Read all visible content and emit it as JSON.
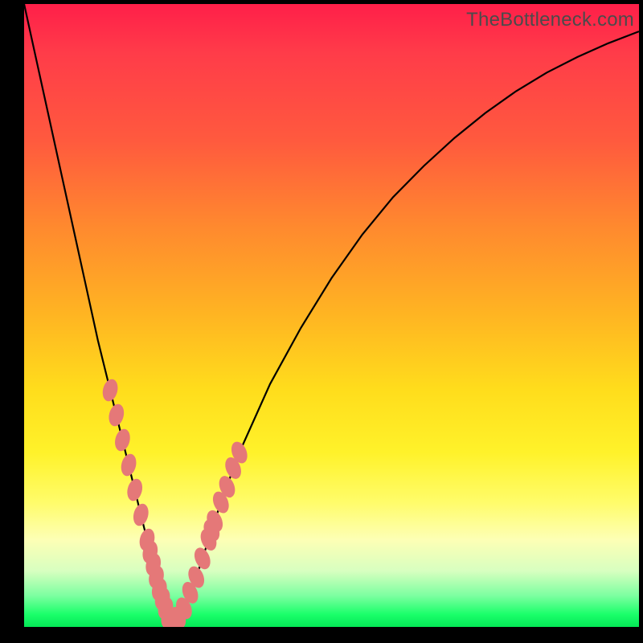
{
  "watermark": "TheBottleneck.com",
  "colors": {
    "dot": "#e57878",
    "line": "#000000",
    "gradient_top": "#ff1f49",
    "gradient_bottom": "#04e756"
  },
  "chart_data": {
    "type": "line",
    "title": "",
    "xlabel": "",
    "ylabel": "",
    "xlim": [
      0,
      100
    ],
    "ylim": [
      0,
      100
    ],
    "x": [
      0,
      2,
      4,
      6,
      8,
      10,
      12,
      14,
      16,
      18,
      19,
      20,
      21,
      22,
      23,
      24,
      26,
      28,
      30,
      32,
      35,
      40,
      45,
      50,
      55,
      60,
      65,
      70,
      75,
      80,
      85,
      90,
      95,
      100
    ],
    "values": [
      100,
      91,
      82,
      73,
      64,
      55,
      46,
      38,
      30,
      22,
      18,
      14,
      10,
      6,
      3,
      0,
      3,
      8,
      14,
      20,
      28,
      39,
      48,
      56,
      63,
      69,
      74,
      78.5,
      82.5,
      86,
      89,
      91.5,
      93.7,
      95.6
    ],
    "data_points": [
      {
        "x": 14,
        "y": 38
      },
      {
        "x": 15,
        "y": 34
      },
      {
        "x": 16,
        "y": 30
      },
      {
        "x": 17,
        "y": 26
      },
      {
        "x": 18,
        "y": 22
      },
      {
        "x": 19,
        "y": 18
      },
      {
        "x": 20,
        "y": 14
      },
      {
        "x": 20.5,
        "y": 12
      },
      {
        "x": 21,
        "y": 10
      },
      {
        "x": 21.5,
        "y": 8
      },
      {
        "x": 22,
        "y": 6
      },
      {
        "x": 22.5,
        "y": 4.5
      },
      {
        "x": 23,
        "y": 3
      },
      {
        "x": 23.5,
        "y": 1.5
      },
      {
        "x": 24,
        "y": 0.5
      },
      {
        "x": 24.5,
        "y": 0.5
      },
      {
        "x": 25,
        "y": 1.5
      },
      {
        "x": 26,
        "y": 3
      },
      {
        "x": 27,
        "y": 5.5
      },
      {
        "x": 28,
        "y": 8
      },
      {
        "x": 29,
        "y": 11
      },
      {
        "x": 30,
        "y": 14
      },
      {
        "x": 30.5,
        "y": 15.5
      },
      {
        "x": 31,
        "y": 17
      },
      {
        "x": 32,
        "y": 20
      },
      {
        "x": 33,
        "y": 22.5
      },
      {
        "x": 34,
        "y": 25.5
      },
      {
        "x": 35,
        "y": 28
      }
    ]
  }
}
